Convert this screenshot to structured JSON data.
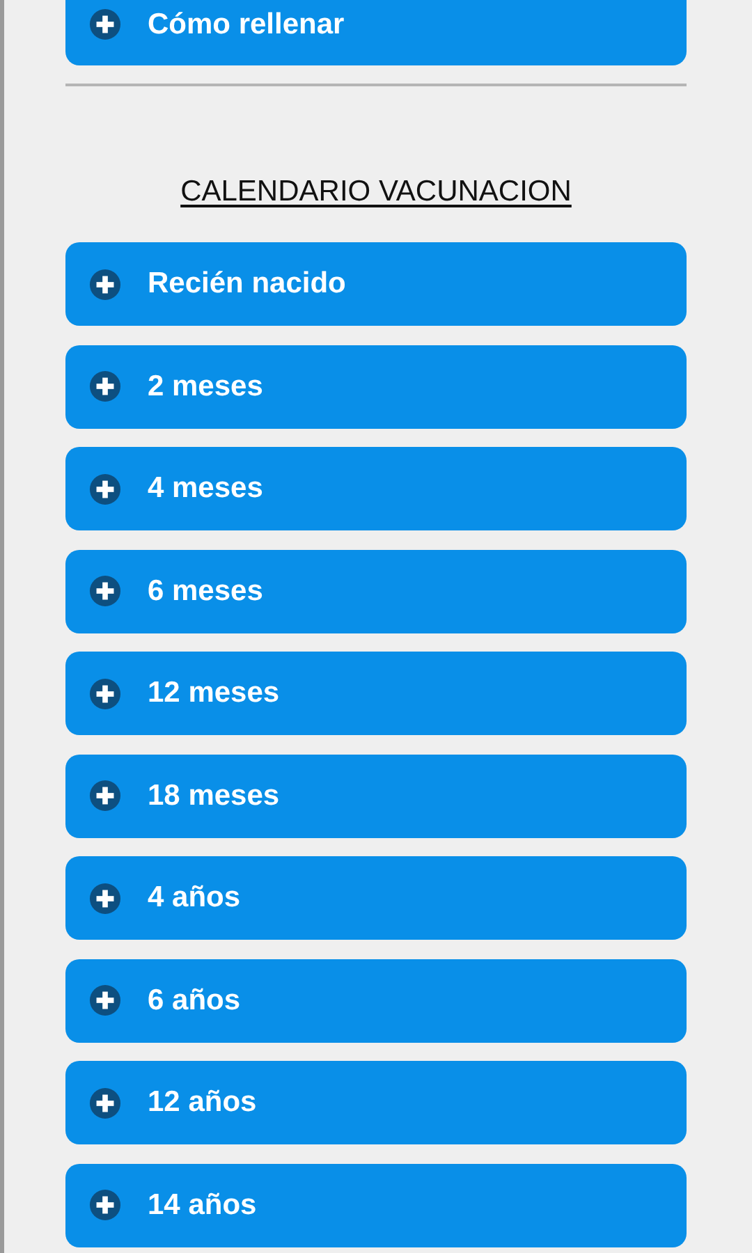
{
  "top_section": {
    "label": "Cómo rellenar",
    "expanded": false
  },
  "heading": "CALENDARIO VACUNACION",
  "sections": [
    {
      "label": "Recién nacido",
      "expanded": false
    },
    {
      "label": "2 meses",
      "expanded": false
    },
    {
      "label": "4 meses",
      "expanded": false
    },
    {
      "label": "6 meses",
      "expanded": false
    },
    {
      "label": "12 meses",
      "expanded": false
    },
    {
      "label": "18 meses",
      "expanded": false
    },
    {
      "label": "4 años",
      "expanded": false
    },
    {
      "label": "6 años",
      "expanded": false
    },
    {
      "label": "12 años",
      "expanded": false
    },
    {
      "label": "14 años",
      "expanded": false
    }
  ]
}
